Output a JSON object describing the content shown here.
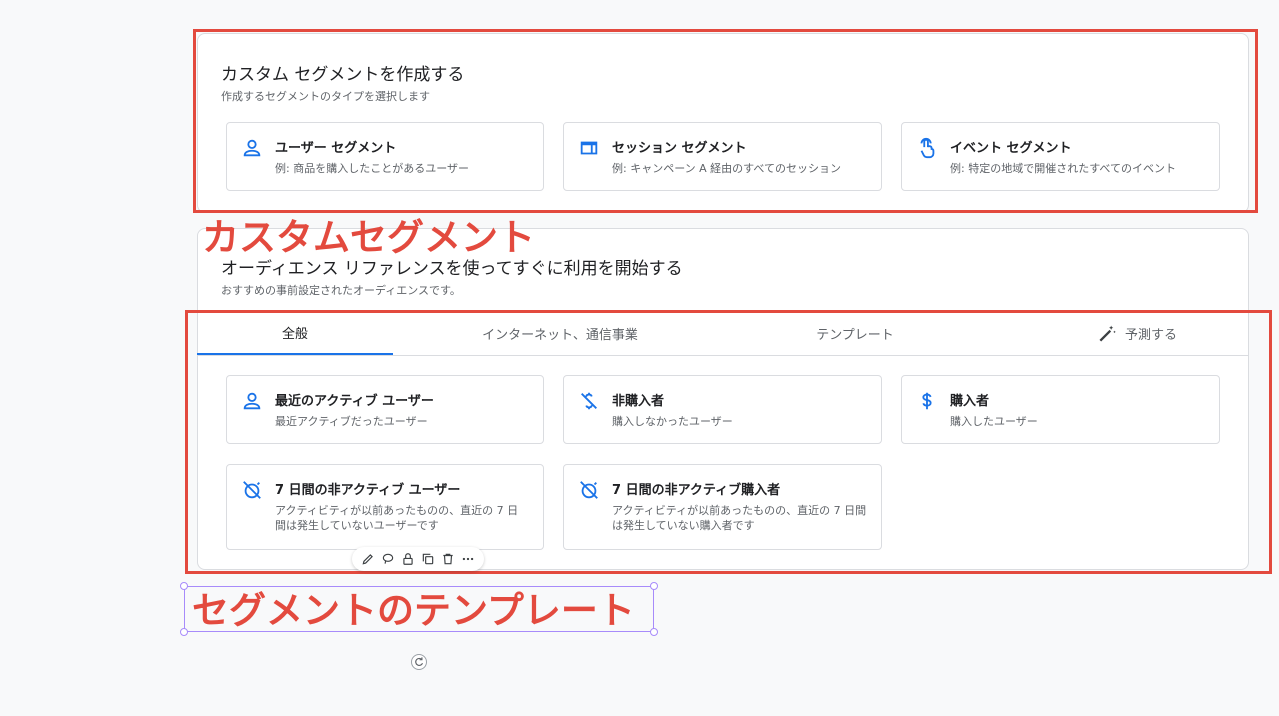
{
  "custom": {
    "title": "カスタム セグメントを作成する",
    "subtitle": "作成するセグメントのタイプを選択します",
    "options": [
      {
        "icon": "person-icon",
        "title": "ユーザー セグメント",
        "desc": "例: 商品を購入したことがあるユーザー"
      },
      {
        "icon": "session-icon",
        "title": "セッション セグメント",
        "desc": "例: キャンペーン A 経由のすべてのセッション"
      },
      {
        "icon": "touch-icon",
        "title": "イベント セグメント",
        "desc": "例: 特定の地域で開催されたすべてのイベント"
      }
    ]
  },
  "reference": {
    "title": "オーディエンス リファレンスを使ってすぐに利用を開始する",
    "subtitle": "おすすめの事前設定されたオーディエンスです。",
    "tabs": [
      {
        "label": "全般",
        "active": true
      },
      {
        "label": "インターネット、通信事業",
        "active": false
      },
      {
        "label": "テンプレート",
        "active": false
      },
      {
        "label": "予測する",
        "active": false,
        "icon": "magic-wand-icon"
      }
    ],
    "templates": [
      {
        "icon": "person-icon",
        "title": "最近のアクティブ ユーザー",
        "desc": "最近アクティブだったユーザー"
      },
      {
        "icon": "money-off-icon",
        "title": "非購入者",
        "desc": "購入しなかったユーザー"
      },
      {
        "icon": "dollar-icon",
        "title": "購入者",
        "desc": "購入したユーザー"
      },
      {
        "icon": "alarm-off-icon",
        "title": "7 日間の非アクティブ ユーザー",
        "desc": "アクティビティが以前あったものの、直近の 7 日間は発生していないユーザーです"
      },
      {
        "icon": "alarm-off-icon",
        "title": "7 日間の非アクティブ購入者",
        "desc": "アクティビティが以前あったものの、直近の 7 日間は発生していない購入者です"
      }
    ]
  },
  "annotations": {
    "custom_label": "カスタムセグメント",
    "template_label": "セグメントのテンプレート",
    "color": "#e34a3e"
  },
  "colors": {
    "accent": "#1a73e8",
    "annotation": "#e34a3e",
    "selection": "#a78bfa"
  }
}
